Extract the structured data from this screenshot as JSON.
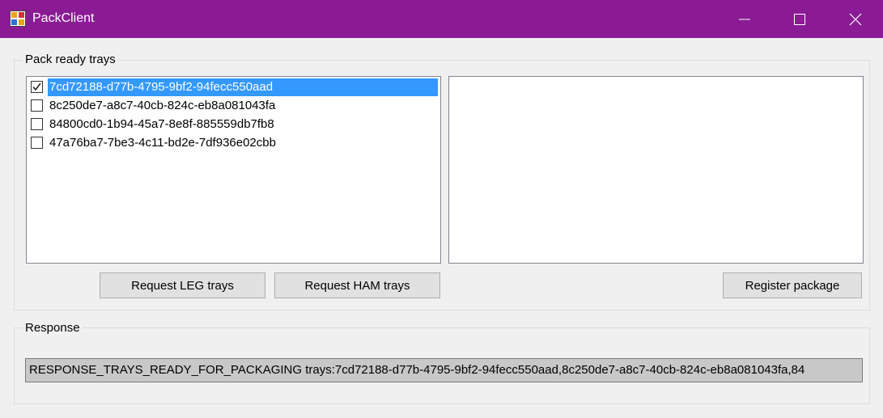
{
  "window": {
    "title": "PackClient",
    "icon": "winforms-app-icon",
    "controls": [
      "minimize-icon",
      "maximize-icon",
      "close-icon"
    ],
    "title_bar_color": "#8a1b94"
  },
  "pack_group": {
    "label": "Pack ready trays",
    "trays": [
      {
        "id": "7cd72188-d77b-4795-9bf2-94fecc550aad",
        "checked": true,
        "selected": true
      },
      {
        "id": "8c250de7-a8c7-40cb-824c-eb8a081043fa",
        "checked": false,
        "selected": false
      },
      {
        "id": "84800cd0-1b94-45a7-8e8f-885559db7fb8",
        "checked": false,
        "selected": false
      },
      {
        "id": "47a76ba7-7be3-4c11-bd2e-7df936e02cbb",
        "checked": false,
        "selected": false
      }
    ],
    "selection_color": "#3399ff",
    "buttons": {
      "request_leg": "Request LEG trays",
      "request_ham": "Request HAM trays",
      "register": "Register package"
    }
  },
  "response_group": {
    "label": "Response",
    "value": "RESPONSE_TRAYS_READY_FOR_PACKAGING trays:7cd72188-d77b-4795-9bf2-94fecc550aad,8c250de7-a8c7-40cb-824c-eb8a081043fa,84"
  }
}
